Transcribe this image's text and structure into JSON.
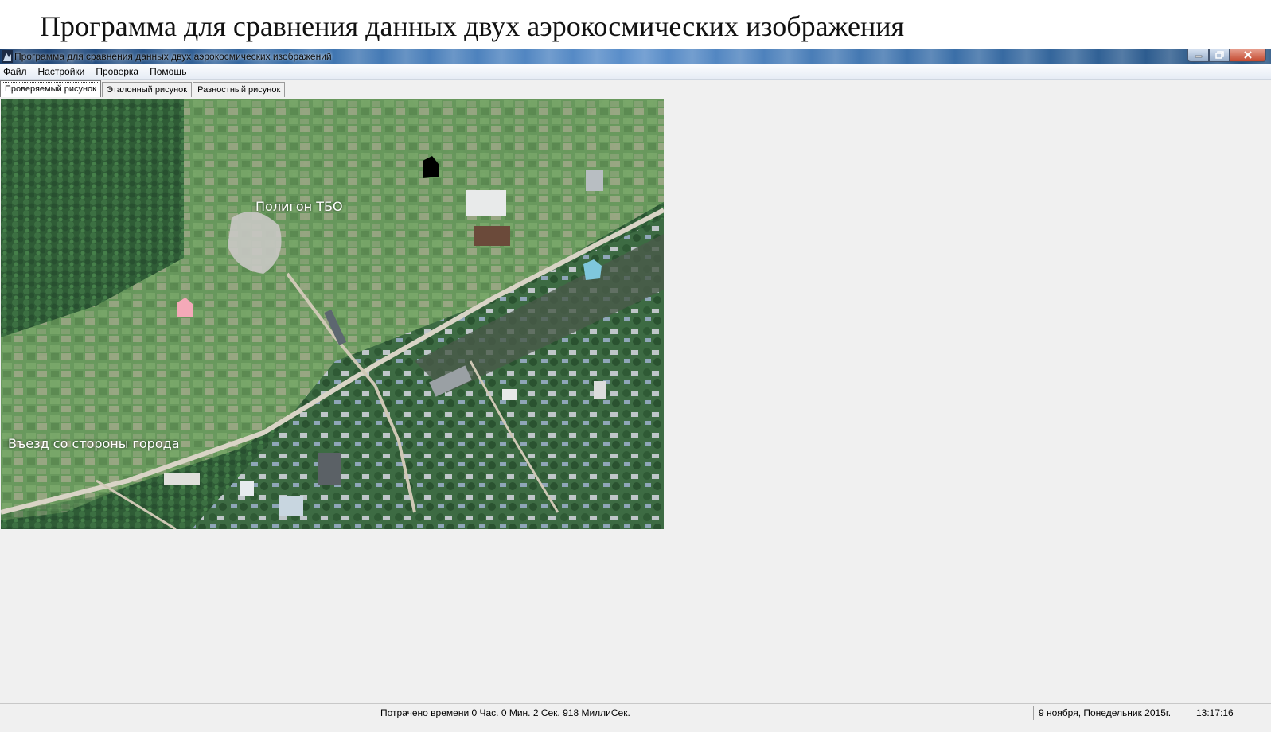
{
  "page_heading": "Программа для сравнения данных двух аэрокосмических изображения",
  "window": {
    "title": "Программа для  сравнения данных двух аэрокосмических изображений",
    "controls": [
      "minimize-icon",
      "maximize-icon",
      "close-icon"
    ]
  },
  "menu": [
    "Файл",
    "Настройки",
    "Проверка",
    "Помощь"
  ],
  "tabs": [
    {
      "label": "Проверяемый рисунок",
      "active": true
    },
    {
      "label": "Эталонный рисунок",
      "active": false
    },
    {
      "label": "Разностный рисунок",
      "active": false
    }
  ],
  "image": {
    "labels": {
      "landfill": "Полигон ТБО",
      "entrance": "Въезд со стороны города"
    },
    "markers": [
      {
        "name": "black",
        "color": "#000000"
      },
      {
        "name": "pink",
        "color": "#f4a9b8"
      },
      {
        "name": "cyan",
        "color": "#7fc7dc"
      }
    ]
  },
  "status": {
    "elapsed": "Потрачено времени  0 Час. 0 Мин. 2 Сек. 918 МиллиСек.",
    "date": "9 ноября, Понедельник 2015г.",
    "time": "13:17:16"
  },
  "colors": {
    "forest": "#2d5a33",
    "field": "#5f8f58",
    "road": "#d9d4c6"
  }
}
